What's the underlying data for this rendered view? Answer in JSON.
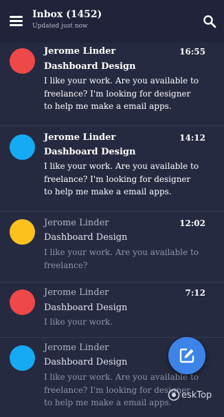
{
  "header": {
    "title": "Inbox (1452)",
    "subtitle": "Updated just now"
  },
  "emails": [
    {
      "sender": "Jerome Linder",
      "time": "16:55",
      "subject": "Dashboard Design",
      "preview": "I like your work. Are you available to freelance? I'm looking for designer to help me make a email apps.",
      "avatar_color": "#ef4848",
      "status": "unread"
    },
    {
      "sender": "Jerome Linder",
      "time": "14:12",
      "subject": "Dashboard Design",
      "preview": "I like your work. Are you available to freelance? I'm looking for designer to help me make a email apps.",
      "avatar_color": "#16aaf5",
      "status": "unread"
    },
    {
      "sender": "Jerome Linder",
      "time": "12:02",
      "subject": "Dashboard Design",
      "preview": "I like your work. Are you available to freelance?",
      "avatar_color": "#fdc11d",
      "status": "read"
    },
    {
      "sender": "Jerome Linder",
      "time": "7:12",
      "subject": "Dashboard Design",
      "preview": "I like your work.",
      "avatar_color": "#ef4848",
      "status": "read"
    },
    {
      "sender": "Jerome Linder",
      "time": "",
      "subject": "Dashboard Design",
      "preview": "I like your work. Are you available to freelance? I'm looking for designer to help me make a email apps.",
      "avatar_color": "#16aaf5",
      "status": "read"
    }
  ],
  "icons": {
    "menu": "menu-icon",
    "search": "search-icon",
    "compose": "compose-icon"
  },
  "watermark": {
    "text": "eskTop"
  }
}
